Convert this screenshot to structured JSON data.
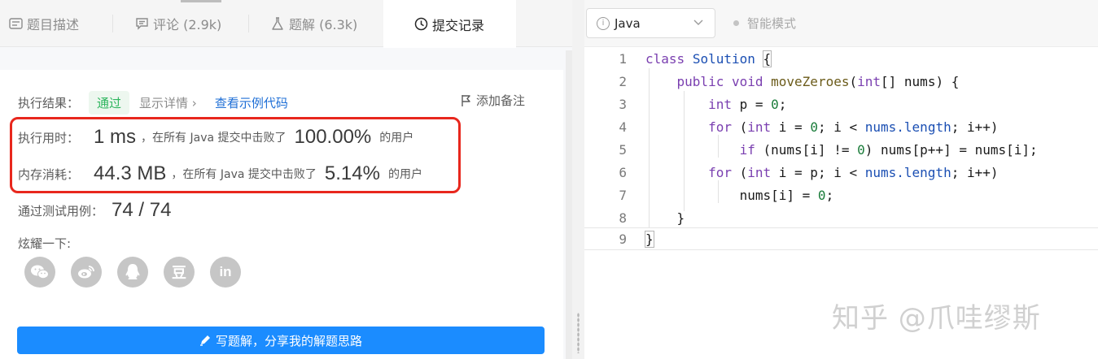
{
  "tabs": [
    {
      "label": "题目描述",
      "icon": "description-icon"
    },
    {
      "label": "评论 (2.9k)",
      "icon": "comment-icon"
    },
    {
      "label": "题解 (6.3k)",
      "icon": "flask-icon"
    },
    {
      "label": "提交记录",
      "icon": "clock-icon",
      "active": true
    }
  ],
  "result": {
    "label": "执行结果：",
    "status": "通过",
    "details": "显示详情 ›",
    "example_link": "查看示例代码",
    "add_note": "添加备注"
  },
  "runtime": {
    "label": "执行用时：",
    "value": "1 ms",
    "mid_text": "，在所有 Java 提交中击败了",
    "percent": "100.00%",
    "suffix": "的用户"
  },
  "memory": {
    "label": "内存消耗：",
    "value": "44.3 MB",
    "mid_text": "，在所有 Java 提交中击败了",
    "percent": "5.14%",
    "suffix": "的用户"
  },
  "tests": {
    "label": "通过测试用例：",
    "value": "74 / 74"
  },
  "share": {
    "label": "炫耀一下:",
    "buttons": [
      {
        "icon": "wechat-icon",
        "glyph": ""
      },
      {
        "icon": "weibo-icon",
        "glyph": ""
      },
      {
        "icon": "qq-icon",
        "glyph": ""
      },
      {
        "icon": "douban-icon",
        "glyph": "豆"
      },
      {
        "icon": "linkedin-icon",
        "glyph": "in"
      }
    ]
  },
  "write_button": "写题解，分享我的解题思路",
  "editor": {
    "language": "Java",
    "mode": "智能模式",
    "line_numbers": [
      "1",
      "2",
      "3",
      "4",
      "5",
      "6",
      "7",
      "8",
      "9"
    ]
  },
  "watermark": "知乎 @爪哇缪斯",
  "colors": {
    "accent_blue": "#1b8cff",
    "pass_green": "#2db55d",
    "highlight_red": "#e8271d"
  }
}
